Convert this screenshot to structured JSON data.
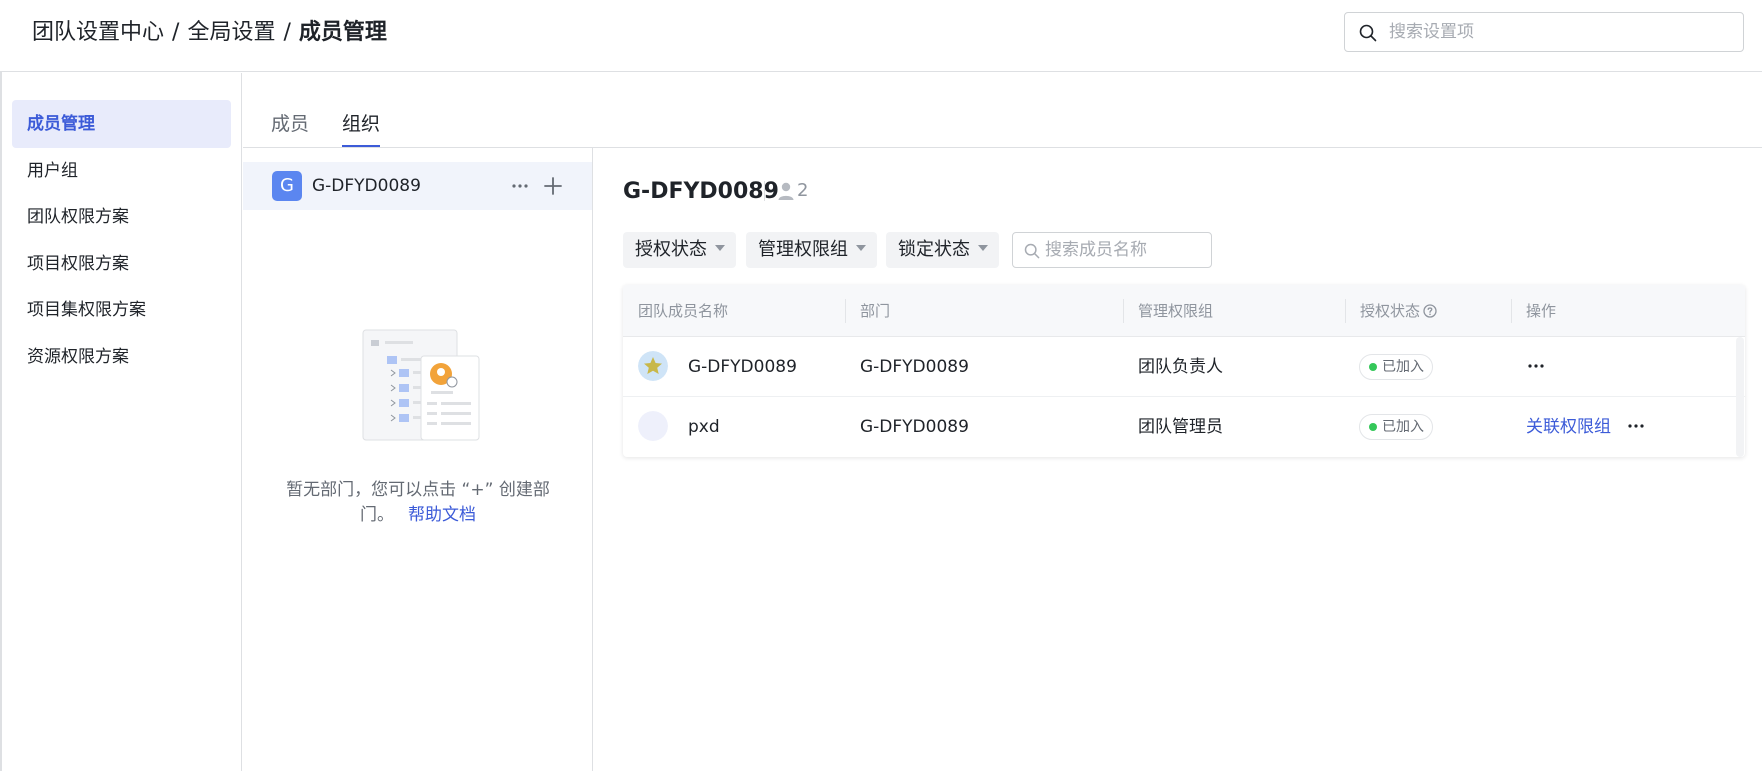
{
  "header": {
    "breadcrumb": [
      "团队设置中心",
      "全局设置",
      "成员管理"
    ],
    "separator": "/",
    "search_placeholder": "搜索设置项"
  },
  "sidebar": {
    "items": [
      {
        "label": "成员管理",
        "active": true
      },
      {
        "label": "用户组"
      },
      {
        "label": "团队权限方案"
      },
      {
        "label": "项目权限方案"
      },
      {
        "label": "项目集权限方案"
      },
      {
        "label": "资源权限方案"
      }
    ]
  },
  "tabs": [
    {
      "label": "成员",
      "active": false
    },
    {
      "label": "组织",
      "active": true
    }
  ],
  "org_tree": {
    "root": {
      "badge": "G",
      "name": "G-DFYD0089"
    },
    "empty_text": "暂无部门，您可以点击 “+” 创建部门。",
    "help_link": "帮助文档"
  },
  "detail": {
    "title": "G-DFYD0089",
    "member_count": "2",
    "filters": [
      "授权状态",
      "管理权限组",
      "锁定状态"
    ],
    "member_search_placeholder": "搜索成员名称"
  },
  "table": {
    "columns": [
      "团队成员名称",
      "部门",
      "管理权限组",
      "授权状态",
      "操作"
    ],
    "rows": [
      {
        "name": "G-DFYD0089",
        "department": "G-DFYD0089",
        "permission_group": "团队负责人",
        "status": "已加入",
        "action_link": ""
      },
      {
        "name": "pxd",
        "department": "G-DFYD0089",
        "permission_group": "团队管理员",
        "status": "已加入",
        "action_link": "关联权限组"
      }
    ]
  },
  "colors": {
    "accent": "#3c5bd8",
    "active_bg": "#e8ebfb",
    "status_green": "#34c759",
    "org_badge": "#5b86f0"
  }
}
